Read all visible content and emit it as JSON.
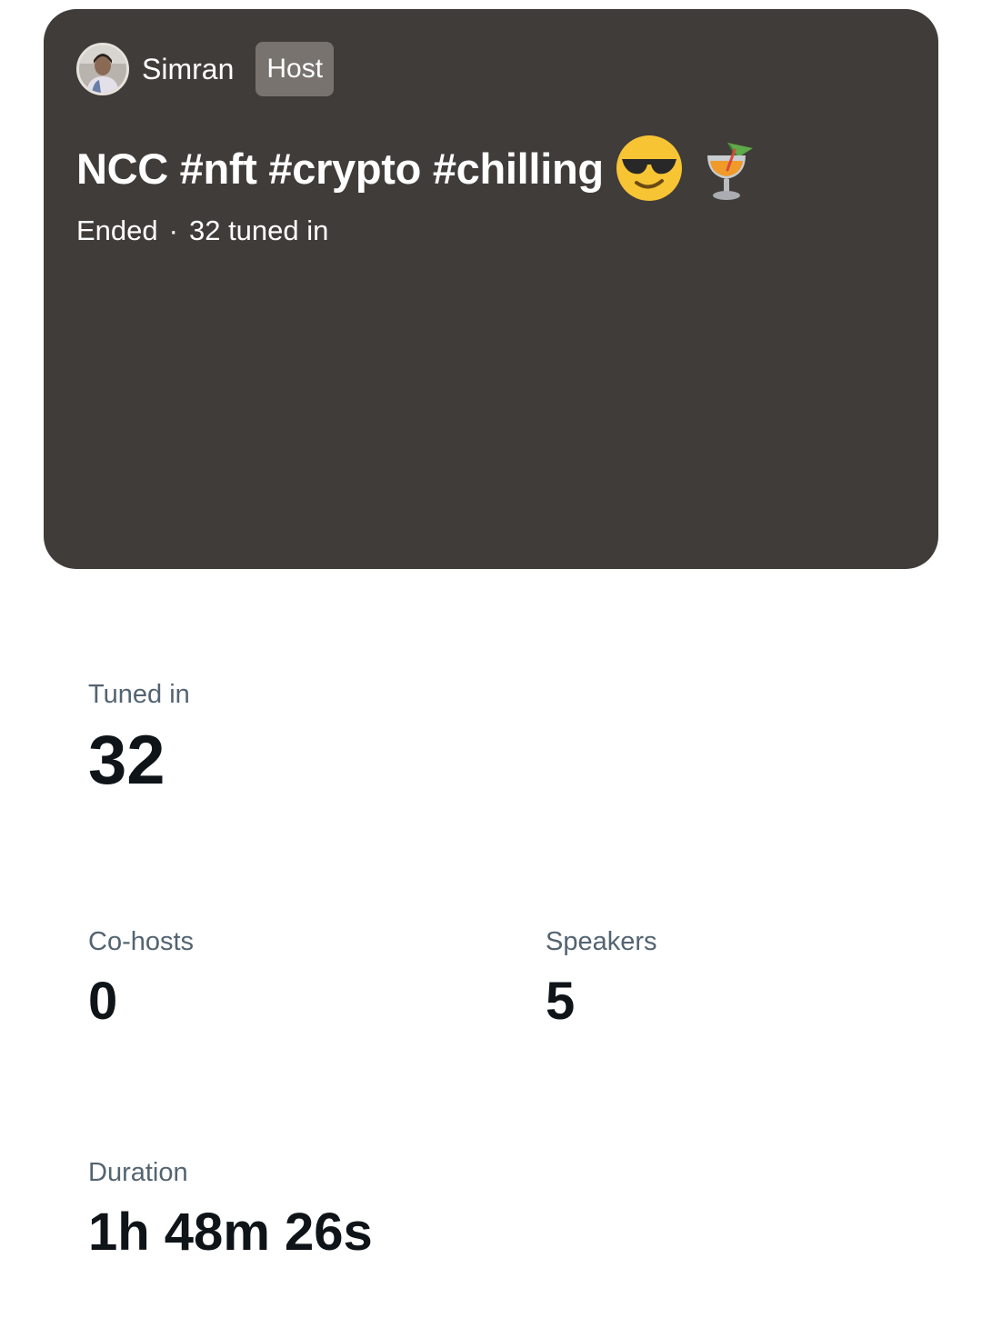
{
  "space": {
    "host_name": "Simran",
    "host_badge": "Host",
    "title": "NCC #nft #crypto #chilling",
    "title_emojis": [
      "sunglasses-face-icon",
      "tropical-drink-icon"
    ],
    "status": "Ended",
    "separator": "·",
    "tuned_in_text": "32 tuned in"
  },
  "stats": {
    "tuned_in": {
      "label": "Tuned in",
      "value": "32"
    },
    "cohosts": {
      "label": "Co-hosts",
      "value": "0"
    },
    "speakers": {
      "label": "Speakers",
      "value": "5"
    },
    "duration": {
      "label": "Duration",
      "value": "1h 48m 26s"
    }
  },
  "colors": {
    "card_bg": "#403c39",
    "badge_bg": "#78736f",
    "label": "#536471",
    "value": "#0f1419"
  }
}
